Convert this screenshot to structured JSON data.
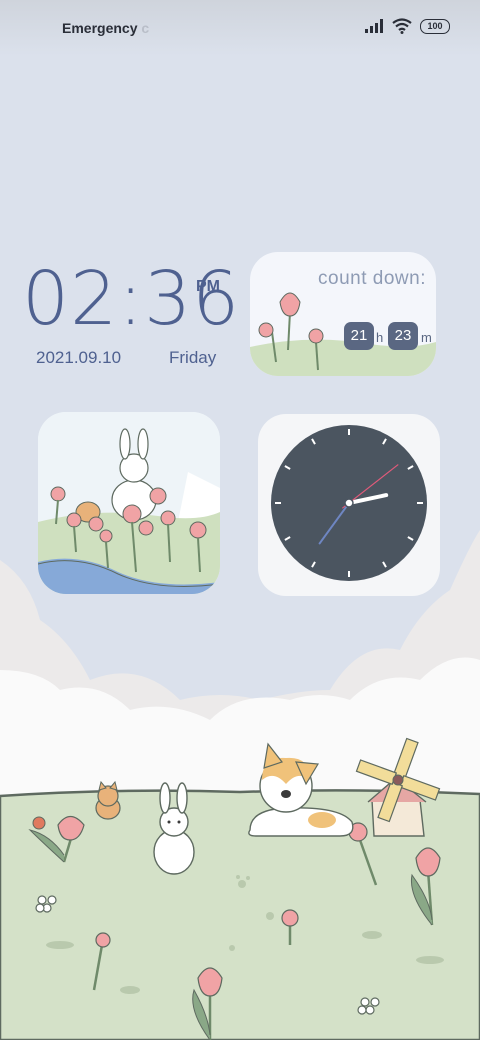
{
  "status_bar": {
    "carrier": "Emergency",
    "carrier_suffix": "c",
    "battery": "100"
  },
  "clock": {
    "time": "02:36",
    "ampm": "PM",
    "date": "2021.09.10",
    "day": "Friday"
  },
  "countdown": {
    "title": "count down:",
    "hours": "21",
    "hours_unit": "h",
    "minutes": "23",
    "minutes_unit": "m"
  },
  "analog_clock": {
    "hour": 2,
    "minute": 36,
    "face_color": "#4b5560",
    "hand_color": "#ffffff",
    "second_hand_color": "#e05a7a"
  },
  "colors": {
    "sky": "#dbe1ec",
    "accent": "#4f6190",
    "grass": "#d4e1c8",
    "tulip": "#f0a3a5"
  }
}
